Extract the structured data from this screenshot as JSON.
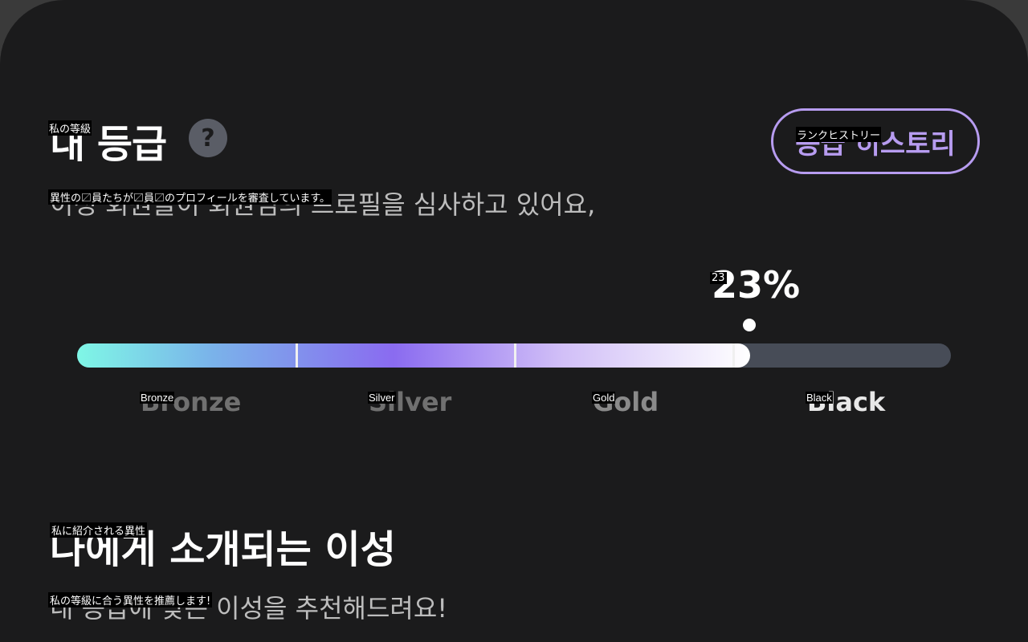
{
  "rank": {
    "title": "내 등급",
    "title_overlay": "私の等級",
    "help_symbol": "?",
    "subtext": "이성 회원들이 회원님의 프로필을 심사하고 있어요,",
    "subtext_overlay": "異性の〼員たちが〼員〼のプロフィールを審査しています。",
    "history_button": "등급 히스토리",
    "history_overlay": "ランクヒストリー",
    "progress": {
      "percent_label": "23%",
      "percent_overlay": "23",
      "fill_fraction": 0.77,
      "tiers": [
        {
          "label": "Bronze",
          "overlay": "Bronze",
          "color": "#707070"
        },
        {
          "label": "Silver",
          "overlay": "Silver",
          "color": "#707070"
        },
        {
          "label": "Gold",
          "overlay": "Gold",
          "color": "#8a8a8a"
        },
        {
          "label": "Black",
          "overlay": "Black",
          "color": "#e8e8e8"
        }
      ]
    }
  },
  "recommend": {
    "title": "나에게 소개되는 이성",
    "title_overlay": "私に紹介される異性",
    "subtext": "내 등급에 맞는 이성을 추천해드려요!",
    "subtext_overlay": "私の等級に合う異性を推薦します!"
  },
  "colors": {
    "background": "#1b1b1c",
    "accent": "#b79cf0",
    "track": "#474c57"
  },
  "icons": {
    "help": "question-circle-icon",
    "marker": "progress-marker-dot"
  }
}
